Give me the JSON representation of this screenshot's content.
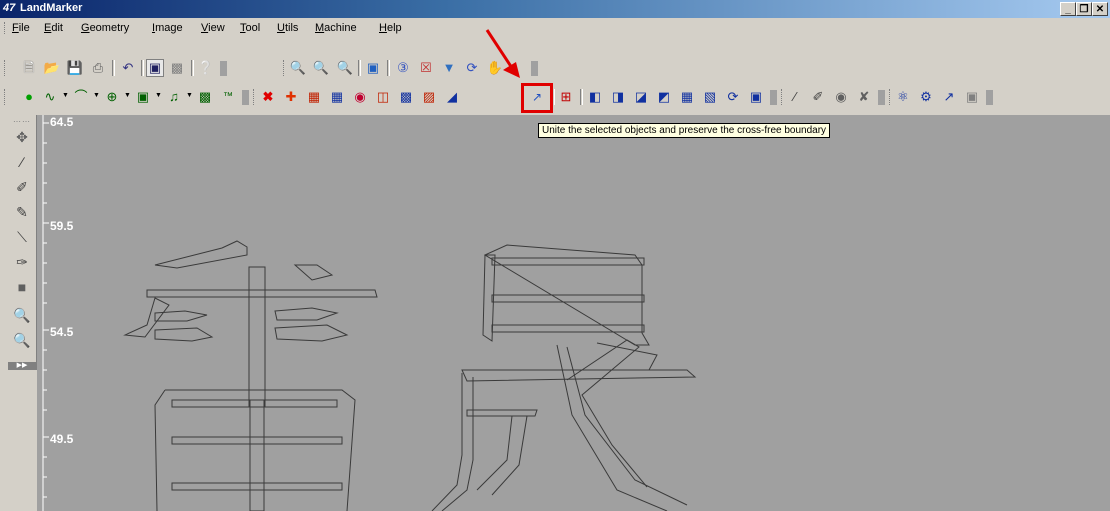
{
  "window": {
    "title": "LandMarker",
    "controls": [
      "_",
      "❐",
      "✕"
    ]
  },
  "menu": [
    "File",
    "Edit",
    "Geometry",
    "Image",
    "View",
    "Tool",
    "Utils",
    "Machine",
    "Help"
  ],
  "menu_underline": [
    "F",
    "E",
    "G",
    "I",
    "V",
    "T",
    "U",
    "M",
    "H"
  ],
  "tooltip": {
    "text": "Unite the selected objects and preserve the cross-free boundary"
  },
  "ruler": {
    "labels": [
      "64.5",
      "59.5",
      "54.5",
      "49.5"
    ]
  },
  "colors": {
    "canvas": "#a0a0a0",
    "highlight": "#e00000",
    "titlebar": "#0a246a"
  }
}
